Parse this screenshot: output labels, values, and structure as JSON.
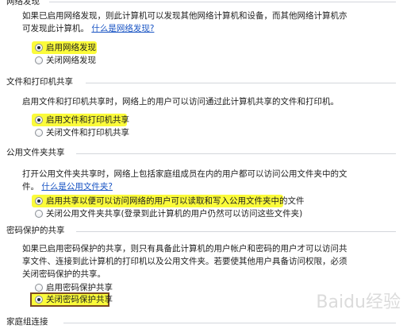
{
  "sections": {
    "network_discovery": {
      "header": "网络发现",
      "description": "如果已启用网络发现，则此计算机可以发现其他网络计算机和设备，而其他网络计算机亦可发现此计算机。",
      "help_link": "什么是网络发现?",
      "options": [
        "启用网络发现",
        "关闭网络发现"
      ],
      "selected_index": 0
    },
    "file_printer_sharing": {
      "header": "文件和打印机共享",
      "description": "启用文件和打印机共享时，网络上的用户可以访问通过此计算机共享的文件和打印机。",
      "options": [
        "启用文件和打印机共享",
        "关闭文件和打印机共享"
      ],
      "selected_index": 0
    },
    "public_folder_sharing": {
      "header": "公用文件夹共享",
      "description": "打开公用文件夹共享时，网络上包括家庭组成员在内的用户都可以访问公用文件夹中的文件。",
      "help_link": "什么是公用文件夹?",
      "options": [
        "启用共享以便可以访问网络的用户可以读取和写入公用文件夹中的文件",
        "关闭公用文件夹共享(登录到此计算机的用户仍然可以访问这些文件夹)"
      ],
      "selected_index": 0
    },
    "password_protected_sharing": {
      "header": "密码保护的共享",
      "description": "如果已启用密码保护的共享，则只有具备此计算机的用户帐户和密码的用户才可以访问共享文件、连接到此计算机的打印机以及公用文件夹。若要使其他用户具备访问权限，必须关闭密码保护的共享。",
      "options": [
        "启用密码保护共享",
        "关闭密码保护共享"
      ],
      "selected_index": 1
    },
    "homegroup_connections": {
      "header": "家庭组连接"
    }
  },
  "colors": {
    "highlight": "#fbfb3a",
    "highlight_border": "#7a4a22",
    "link": "#1a55c4",
    "rule": "#d3d6db"
  },
  "watermark": "Baidu经验"
}
